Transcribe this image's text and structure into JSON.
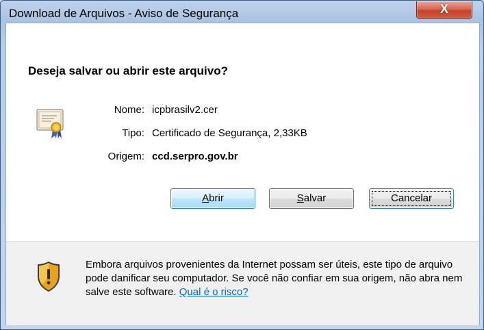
{
  "window": {
    "title": "Download de Arquivos - Aviso de Segurança",
    "close_glyph": "X"
  },
  "dialog": {
    "question": "Deseja salvar ou abrir este arquivo?",
    "file_icon": "certificate-icon",
    "fields": {
      "name_label": "Nome:",
      "name_value": "icpbrasilv2.cer",
      "type_label": "Tipo:",
      "type_value": "Certificado de Segurança, 2,33KB",
      "origin_label": "Origem:",
      "origin_value": "ccd.serpro.gov.br"
    },
    "buttons": {
      "open_mnemonic": "A",
      "open_rest": "brir",
      "save_mnemonic": "S",
      "save_rest": "alvar",
      "cancel_label": "Cancelar"
    },
    "warning": {
      "icon": "security-shield-icon",
      "text": "Embora arquivos provenientes da Internet possam ser úteis, este tipo de arquivo pode danificar seu computador. Se você não confiar em sua origem, não abra nem salve este software.",
      "link": "Qual é o risco?"
    }
  },
  "colors": {
    "link": "#0066cc",
    "close_button": "#c3422b"
  }
}
